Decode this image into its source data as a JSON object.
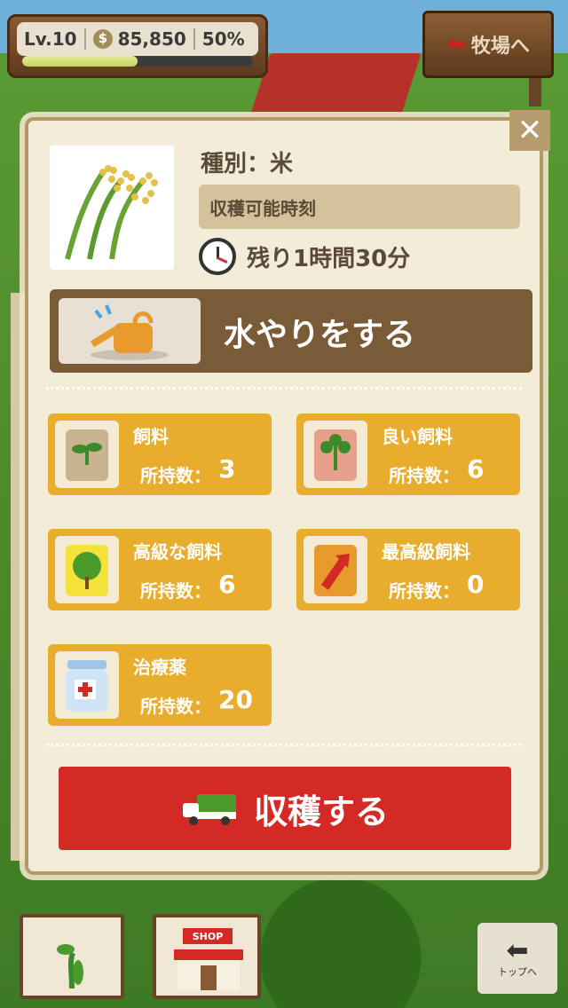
{
  "status": {
    "level": "Lv.10",
    "money": "85,850",
    "percent": "50%",
    "xp_progress": 0.5
  },
  "nav": {
    "ranch_label": "牧場へ",
    "top_label": "トップへ",
    "shop_label": "SHOP"
  },
  "crop": {
    "type_label": "種別：米",
    "harvest_time_label": "収穫可能時刻",
    "remaining": "残り1時間30分"
  },
  "water": {
    "label": "水やりをする"
  },
  "items": [
    {
      "name": "飼料",
      "count_label": "所持数：",
      "count": "3",
      "icon": "seedling-bag-icon"
    },
    {
      "name": "良い飼料",
      "count_label": "所持数：",
      "count": "6",
      "icon": "plant-bag-icon"
    },
    {
      "name": "高級な飼料",
      "count_label": "所持数：",
      "count": "6",
      "icon": "tree-bag-icon"
    },
    {
      "name": "最高級飼料",
      "count_label": "所持数：",
      "count": "0",
      "icon": "arrow-bag-icon"
    },
    {
      "name": "治療薬",
      "count_label": "所持数：",
      "count": "20",
      "icon": "medicine-jar-icon"
    }
  ],
  "harvest": {
    "label": "収穫する"
  },
  "colors": {
    "item_card": "#e8ad2c",
    "harvest_button": "#d42a26",
    "water_button": "#7a5b37",
    "panel_bg": "#f3ecd9"
  }
}
